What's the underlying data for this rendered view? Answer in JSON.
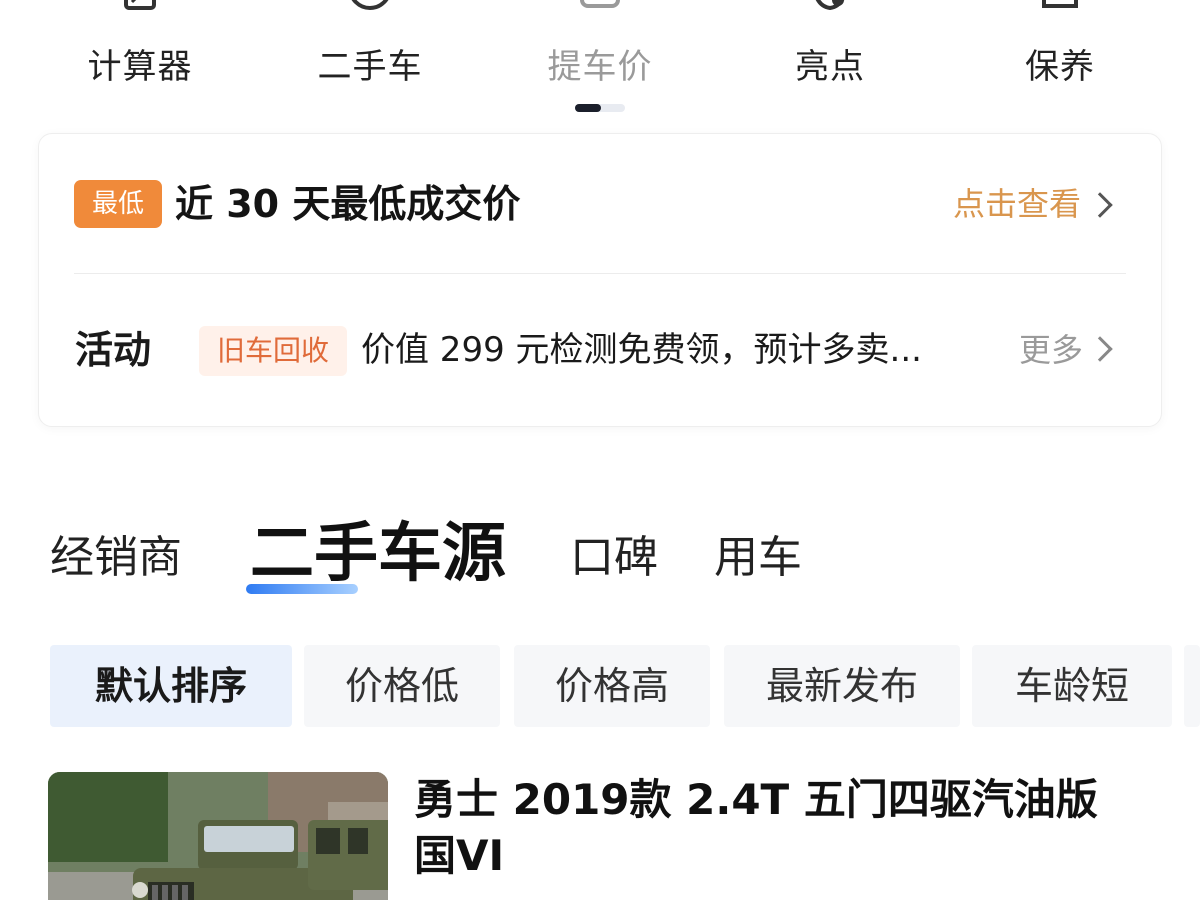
{
  "nav": {
    "items": [
      {
        "label": "计算器",
        "icon": "calculator-icon"
      },
      {
        "label": "二手车",
        "icon": "used-car-icon"
      },
      {
        "label": "提车价",
        "icon": "price-icon"
      },
      {
        "label": "亮点",
        "icon": "highlight-icon"
      },
      {
        "label": "保养",
        "icon": "maintenance-icon"
      }
    ],
    "active_index": 2
  },
  "lowest_price": {
    "badge": "最低",
    "title": "近 30 天最低成交价",
    "link": "点击查看"
  },
  "activity": {
    "label": "活动",
    "tag": "旧车回收",
    "text": "价值 299 元检测免费领，预计多卖...",
    "more": "更多"
  },
  "section_tabs": [
    "经销商",
    "二手车源",
    "口碑",
    "用车"
  ],
  "sort_options": [
    "默认排序",
    "价格低",
    "价格高",
    "最新发布",
    "车龄短"
  ],
  "listing": {
    "title": "勇士 2019款 2.4T 五门四驱汽油版 国VI"
  },
  "colors": {
    "accent_orange": "#f08a3a",
    "link_orange": "#d9964e",
    "tab_blue": "#2f7bf2"
  }
}
